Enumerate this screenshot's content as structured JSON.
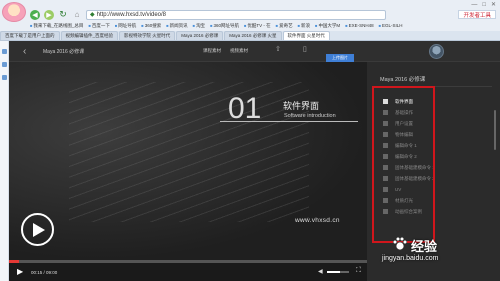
{
  "browser": {
    "title_controls": [
      "―",
      "□",
      "✕"
    ],
    "url": "http://www.hxsd.tv/video/8",
    "open_tool_label": "开发者工具",
    "bookmarks": [
      "我来下载_在路线图_总目",
      "百度一下",
      "网址导航",
      "360搜索",
      "新闻资讯",
      "淘宝",
      "360网址导航",
      "优酷TV - 在",
      "爱奇艺",
      "新浪",
      "中国大学M",
      "EXE-SNH48",
      "EGL-SILH"
    ],
    "tabs": [
      {
        "label": "百度下载了是用户上面的",
        "active": false
      },
      {
        "label": "视频编辑插件_百度经验",
        "active": false
      },
      {
        "label": "影视特效学院 火星时代",
        "active": false
      },
      {
        "label": "Maya 2016 必修课",
        "active": false
      },
      {
        "label": "Maya 2016 必修课 火星",
        "active": false
      },
      {
        "label": "软件界面 火星时代",
        "active": true
      }
    ]
  },
  "site": {
    "course_title": "Maya 2016 必修课",
    "header_links": [
      "课程素材",
      "视频素材"
    ],
    "popup_tag": "上传图片"
  },
  "video": {
    "chapter_number": "01",
    "chapter_title_cn": "软件界面",
    "chapter_title_en": "Software introduction",
    "watermark": "www.vhxsd.cn",
    "current_time": "00:15",
    "duration": "09:00",
    "progress": 0.028,
    "volume": 0.6
  },
  "playlist": {
    "title": "Maya 2016 必修课",
    "items": [
      {
        "label": "软件界面",
        "active": true
      },
      {
        "label": "基础操作",
        "active": false
      },
      {
        "label": "用户设置",
        "active": false
      },
      {
        "label": "物体编辑",
        "active": false
      },
      {
        "label": "编辑命令 1",
        "active": false
      },
      {
        "label": "编辑命令 2",
        "active": false
      },
      {
        "label": "固体基础建模命令 1",
        "active": false
      },
      {
        "label": "固体基础建模命令 2",
        "active": false
      },
      {
        "label": "UV",
        "active": false
      },
      {
        "label": "材质灯光",
        "active": false
      },
      {
        "label": "动画综合案例",
        "active": false
      }
    ]
  },
  "watermark_site": {
    "brand_cn": "经验",
    "url": "jingyan.baidu.com"
  }
}
